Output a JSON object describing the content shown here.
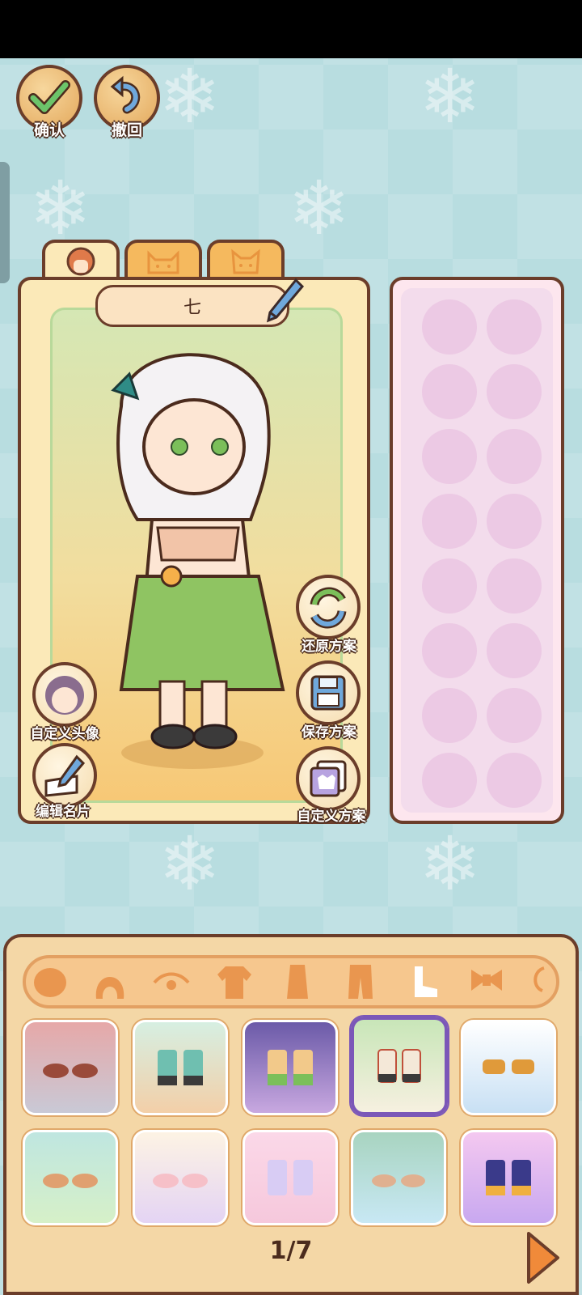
{
  "top_buttons": {
    "confirm_label": "确认",
    "undo_label": "撤回"
  },
  "tabs": [
    {
      "icon": "girl-face-icon"
    },
    {
      "icon": "cat-face-icon"
    },
    {
      "icon": "dog-face-icon"
    }
  ],
  "character": {
    "name": "七"
  },
  "side_actions": {
    "restore_label": "还原方案",
    "save_label": "保存方案",
    "custom_plan_label": "自定义方案",
    "custom_avatar_label": "自定义头像",
    "edit_card_label": "编辑名片"
  },
  "wardrobe": {
    "categories": [
      "face",
      "hair",
      "eyes",
      "top",
      "dress",
      "pants",
      "shoes",
      "accessory"
    ],
    "active_category": "shoes",
    "pagination": "1/7"
  },
  "colors": {
    "accent": "#7b57b8",
    "outline": "#6b3d2a",
    "panel": "#f4d7a6"
  }
}
